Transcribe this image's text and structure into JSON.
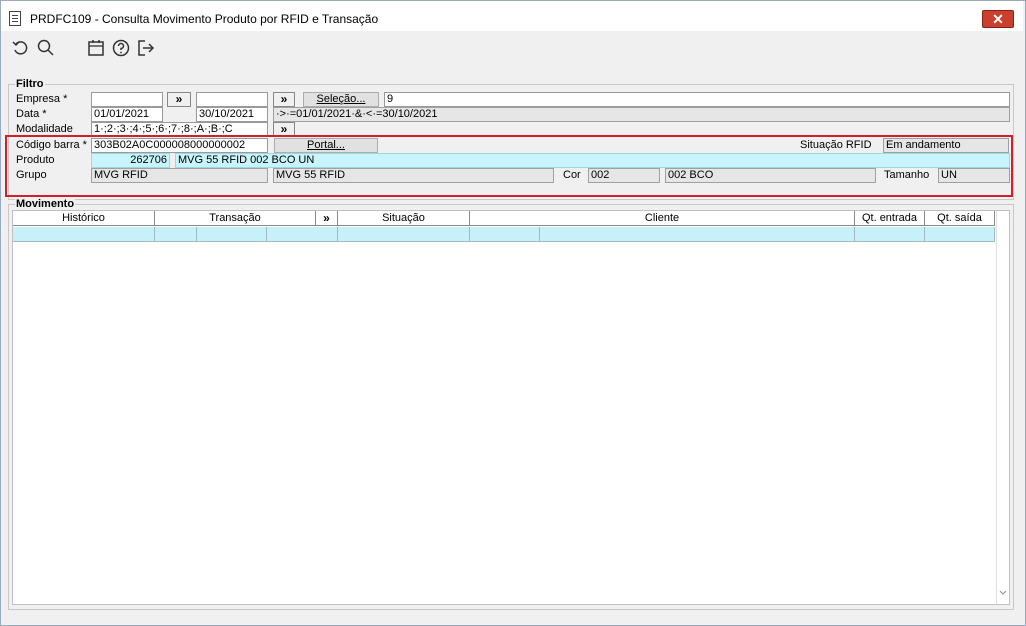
{
  "window": {
    "title": "PRDFC109 - Consulta Movimento Produto por RFID e Transação",
    "close_label": "✕"
  },
  "toolbar": {
    "icons": [
      "undo-icon",
      "search-icon",
      "calendar-icon",
      "help-icon",
      "exit-icon"
    ]
  },
  "filtro": {
    "title": "Filtro",
    "empresa_label": "Empresa *",
    "empresa_value": "",
    "empresa_to_value": "",
    "selecao_label": "Seleção...",
    "selecao_value": "9",
    "data_label": "Data *",
    "data_from": "01/01/2021",
    "data_to": "30/10/2021",
    "data_expr": "·>·=01/01/2021·&·<·=30/10/2021",
    "modalidade_label": "Modalidade",
    "modalidade_value": "1·;2·;3·;4·;5·;6·;7·;8·;A·;B·;C",
    "codigo_label": "Código barra *",
    "codigo_value": "303B02A0C000008000000002",
    "portal_label": "Portal...",
    "situacao_rfid_label": "Situação RFID",
    "situacao_rfid_value": "Em andamento",
    "produto_label": "Produto",
    "produto_code": "262706",
    "produto_desc": "MVG 55 RFID 002 BCO UN",
    "grupo_label": "Grupo",
    "grupo_value": "MVG RFID",
    "grupo_desc": "MVG 55 RFID",
    "cor_label": "Cor",
    "cor_value": "002",
    "cor_desc": "002 BCO",
    "tamanho_label": "Tamanho",
    "tamanho_value": "UN",
    "arrow": "»"
  },
  "movimento": {
    "title": "Movimento",
    "columns": [
      "Histórico",
      "Transação",
      "»",
      "Situação",
      "Cliente",
      "Qt. entrada",
      "Qt. saída"
    ]
  },
  "colors": {
    "highlight_border": "#d0202a",
    "selected_row": "#c8f0f8",
    "close_button": "#c9402f"
  }
}
